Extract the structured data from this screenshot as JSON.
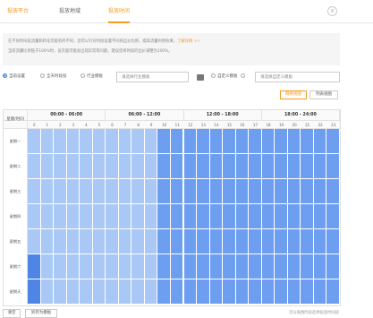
{
  "tabs": [
    {
      "label": "投放平台"
    },
    {
      "label": "投放地域"
    },
    {
      "label": "投放时间"
    }
  ],
  "close_icon": "close-icon",
  "notice": {
    "line1": "在不同时间段流量和转化可能有所不同，您可以针对时段设置不同的出价比例，提高流量利用效果，",
    "learn_more": "了解详情 >>",
    "line2": "当前流量比例低于100%时，该页面可能会出现异常等问题，建议您将时段的出价调整为100%。"
  },
  "modes": {
    "current": "当前设置",
    "all": "全天时段投",
    "industry": "行业模板",
    "industry_placeholder": "请选择行业模板",
    "custom": "自定义模板",
    "custom_placeholder": "请选择自定义模板"
  },
  "views": {
    "grid": "网格视图",
    "list": "列表视图"
  },
  "grid": {
    "corner_label": "星期/时间",
    "bands": [
      "00:00 - 06:00",
      "06:00 - 12:00",
      "12:00 - 18:00",
      "18:00 - 24:00"
    ],
    "hours": [
      "0",
      "1",
      "2",
      "3",
      "4",
      "5",
      "6",
      "7",
      "8",
      "9",
      "10",
      "11",
      "12",
      "13",
      "14",
      "15",
      "16",
      "17",
      "18",
      "19",
      "20",
      "21",
      "22",
      "23"
    ],
    "days": [
      "星期一",
      "星期二",
      "星期三",
      "星期四",
      "星期五",
      "星期六",
      "星期天"
    ],
    "colors": {
      "light": "#a9c8f5",
      "dark": "#6d9ef0",
      "edge": "#4f86e6"
    },
    "dark_from_hour": 10,
    "schedule": [
      "LLLLLLLLLLDDDDDDDDDDDDDD",
      "LLLLLLLLLLDDDDDDDDDDDDDD",
      "LLLLLLLLLLDDDDDDDDDDDDDD",
      "LLLLLLLLLLDDDDDDDDDDDDDD",
      "LLLLLLLLLLDDDDDDDDDDDDDD",
      "ELLLLLLLLLDDDDDDDDDDDDDD",
      "ELLLLLLLLLDDDDDDDDDDDDDD"
    ]
  },
  "footer": {
    "clear": "清空",
    "save_template": "另存为模板",
    "hint": "可以拖拽时段选择投放时间段"
  }
}
